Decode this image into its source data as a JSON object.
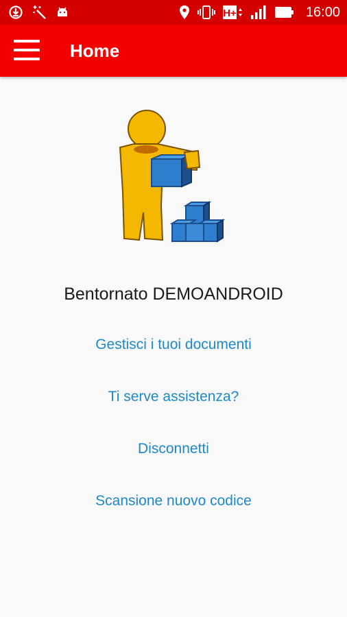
{
  "status_bar": {
    "time": "16:00",
    "network_label": "H+",
    "left_icons": [
      "download-icon",
      "magic-wand-icon",
      "android-icon"
    ],
    "right_icons": [
      "location-icon",
      "vibrate-icon",
      "network-h-plus-icon",
      "signal-icon",
      "battery-icon"
    ]
  },
  "app_bar": {
    "title": "Home",
    "menu_icon": "hamburger-menu-icon",
    "color": "#f40000"
  },
  "main": {
    "illustration": "person-with-boxes-illustration",
    "welcome_text": "Bentornato DEMOANDROID",
    "links": [
      {
        "label": "Gestisci i tuoi documenti"
      },
      {
        "label": "Ti serve assistenza?"
      },
      {
        "label": "Disconnetti"
      },
      {
        "label": "Scansione nuovo codice"
      }
    ],
    "link_color": "#1e88c8"
  }
}
